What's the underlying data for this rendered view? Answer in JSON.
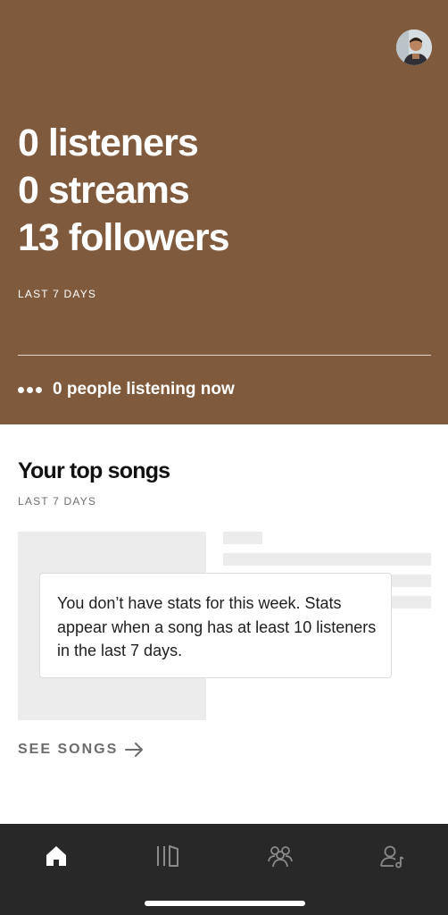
{
  "hero": {
    "stats": [
      "0 listeners",
      "0 streams",
      "13 followers"
    ],
    "period": "LAST 7 DAYS",
    "listening_now": "0 people listening now"
  },
  "top_songs": {
    "title": "Your top songs",
    "period": "LAST 7 DAYS",
    "notice": "You don’t have stats for this week. Stats appear when a song has at least 10 listeners in the last 7 days.",
    "see_songs": "SEE SONGS"
  },
  "nav": {
    "items": [
      {
        "icon": "home-icon",
        "active": true
      },
      {
        "icon": "library-icon",
        "active": false
      },
      {
        "icon": "audience-icon",
        "active": false
      },
      {
        "icon": "profile-icon",
        "active": false
      }
    ],
    "active_color": "#ffffff",
    "inactive_color": "#8a8a8a"
  },
  "colors": {
    "hero_bg": "#7f5a3c",
    "navbar_bg": "#282828",
    "placeholder": "#ececec"
  }
}
